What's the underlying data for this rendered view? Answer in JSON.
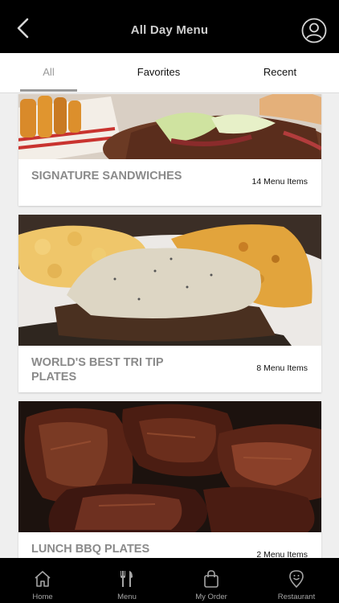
{
  "header": {
    "title": "All Day Menu",
    "back_icon": "chevron-left-icon",
    "profile_icon": "user-circle-icon"
  },
  "tabs": [
    {
      "label": "All",
      "active": true
    },
    {
      "label": "Favorites",
      "active": false
    },
    {
      "label": "Recent",
      "active": false
    }
  ],
  "menu_categories": [
    {
      "title": "SIGNATURE SANDWICHES",
      "count": "14 Menu Items",
      "image": "pulled pork sandwich with coleslaw and fries"
    },
    {
      "title": "WORLD'S BEST TRI TIP PLATES",
      "count": "8 Menu Items",
      "image": "tri tip steak topped with sauce with mac and cheese"
    },
    {
      "title": "LUNCH BBQ PLATES",
      "count": "2 Menu Items",
      "image": "glazed bbq brisket chunks"
    }
  ],
  "bottom_nav": [
    {
      "label": "Home",
      "icon": "home-icon"
    },
    {
      "label": "Menu",
      "icon": "utensils-icon"
    },
    {
      "label": "My Order",
      "icon": "shopping-bag-icon"
    },
    {
      "label": "Restaurant",
      "icon": "location-pin-icon"
    }
  ],
  "colors": {
    "header_bg": "#000000",
    "tab_indicator": "#9a9a9a",
    "title_text": "#8a8a8a"
  }
}
